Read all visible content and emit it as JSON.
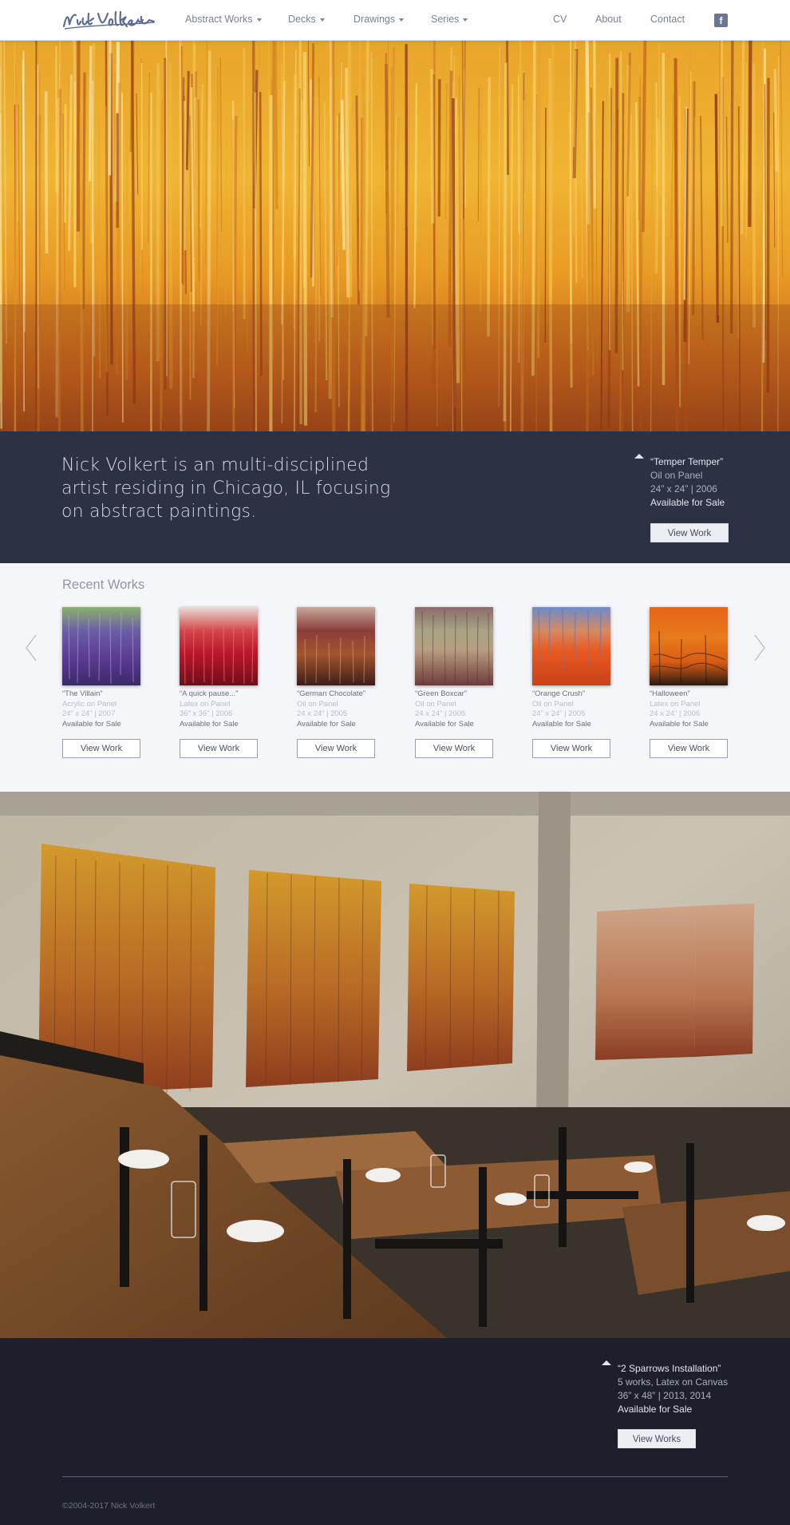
{
  "brand": {
    "logo_text": "Nick Volkert"
  },
  "nav": {
    "items": [
      {
        "label": "Abstract Works",
        "dropdown": true
      },
      {
        "label": "Decks",
        "dropdown": true
      },
      {
        "label": "Drawings",
        "dropdown": true
      },
      {
        "label": "Series",
        "dropdown": true
      }
    ],
    "right_items": [
      {
        "label": "CV"
      },
      {
        "label": "About"
      },
      {
        "label": "Contact"
      }
    ],
    "social_icon": "facebook-icon"
  },
  "intro": {
    "tagline": "Nick Volkert is an multi-disciplined artist residing in Chicago, IL focusing on abstract paintings.",
    "feature": {
      "title": "“Temper Temper”",
      "medium": "Oil on Panel",
      "details": "24” x 24”  | 2006",
      "availability": "Available for Sale",
      "button": "View Work"
    }
  },
  "recent": {
    "heading": "Recent Works",
    "works": [
      {
        "title": "“The Villain”",
        "medium": "Acrylic on Panel",
        "size": "24” x 24”  | 2007",
        "availability": "Available for Sale",
        "button": "View Work"
      },
      {
        "title": "“A quick pause...”",
        "medium": "Latex on Panel",
        "size": "36” x 36”  | 2006",
        "availability": "Available for Sale",
        "button": "View Work"
      },
      {
        "title": "“German Chocolate”",
        "medium": "Oil on Panel",
        "size": "24 x 24”  | 2005",
        "availability": "Available for Sale",
        "button": "View Work"
      },
      {
        "title": "“Green Boxcar”",
        "medium": "Oil on Panel",
        "size": "24 x 24”  | 2005",
        "availability": "Available for Sale",
        "button": "View Work"
      },
      {
        "title": "“Orange Crush”",
        "medium": "Oil on Panel",
        "size": "24” x 24”  | 2005",
        "availability": "Available for Sale",
        "button": "View Work"
      },
      {
        "title": "“Halloween”",
        "medium": "Latex on Panel",
        "size": "24 x 24”  | 2006",
        "availability": "Available for Sale",
        "button": "View Work"
      }
    ]
  },
  "installation": {
    "title": "“2 Sparrows Installation”",
    "medium": "5 works, Latex on Canvas",
    "details": "36” x 48”  | 2013, 2014",
    "availability": "Available for Sale",
    "button": "View Works"
  },
  "footer": {
    "copyright": "©2004-2017 Nick Volkert"
  },
  "colors": {
    "nav_bg": "#ffffff",
    "band_bg": "#2c3143",
    "footer_bg": "#1d202c",
    "page_bg": "#f4f6fa"
  }
}
